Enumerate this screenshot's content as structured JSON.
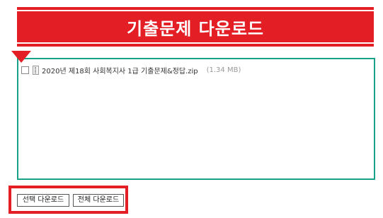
{
  "banner": {
    "title": "기출문제 다운로드"
  },
  "files": [
    {
      "name": "2020년 제18회 사회복지사 1급 기출문제&정답.zip",
      "size": "(1.34 MB)"
    }
  ],
  "buttons": {
    "download_selected": "선택 다운로드",
    "download_all": "전체 다운로드"
  },
  "colors": {
    "accent": "#e31e24",
    "panel_border": "#1aa18a"
  },
  "icons": {
    "file_type": "zip-file-icon",
    "marker": "down-arrow-marker"
  }
}
